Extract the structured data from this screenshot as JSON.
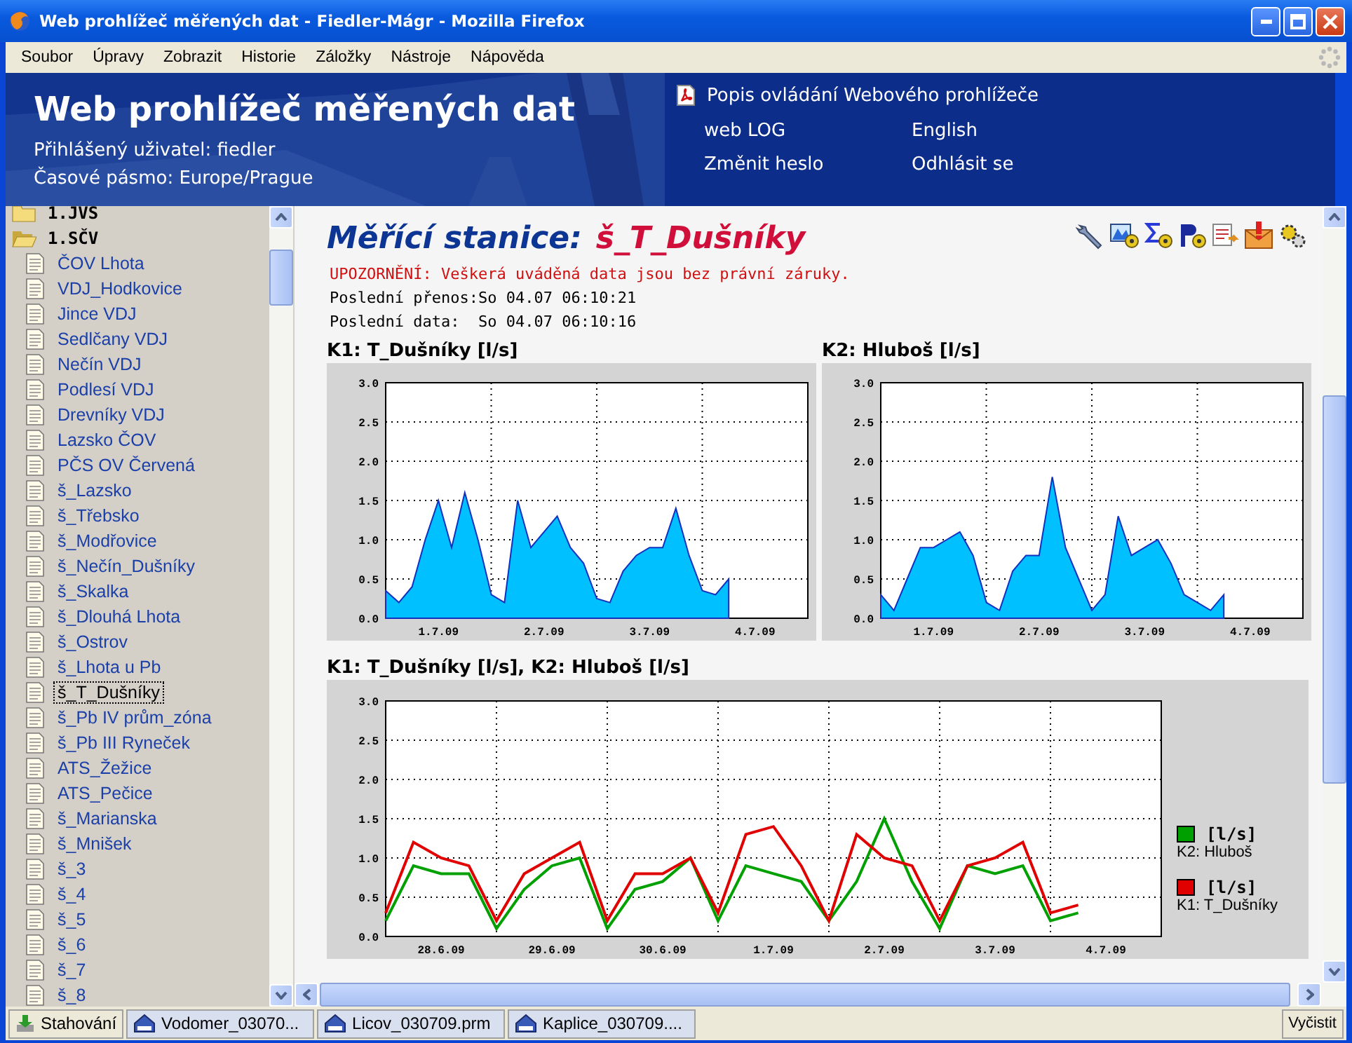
{
  "window": {
    "title": "Web prohlížeč měřených dat - Fiedler-Mágr - Mozilla Firefox"
  },
  "menu": [
    "Soubor",
    "Úpravy",
    "Zobrazit",
    "Historie",
    "Záložky",
    "Nástroje",
    "Nápověda"
  ],
  "header": {
    "title": "Web prohlížeč měřených dat",
    "user": "Přihlášený uživatel: fiedler",
    "timezone": "Časové pásmo: Europe/Prague",
    "manual_link": "Popis ovládání Webového prohlížeče",
    "links": [
      "web LOG",
      "English",
      "Změnit heslo",
      "Odhlásit se"
    ]
  },
  "sidebar": {
    "tree": [
      {
        "label": "1.JVS",
        "expanded": false,
        "selected": false
      },
      {
        "label": "1.SČV",
        "expanded": true,
        "selected": false,
        "children": [
          {
            "label": "ČOV Lhota",
            "selected": false
          },
          {
            "label": "VDJ_Hodkovice",
            "selected": false
          },
          {
            "label": "Jince VDJ",
            "selected": false
          },
          {
            "label": "Sedlčany VDJ",
            "selected": false
          },
          {
            "label": "Nečín VDJ",
            "selected": false
          },
          {
            "label": "Podlesí VDJ",
            "selected": false
          },
          {
            "label": "Drevníky VDJ",
            "selected": false
          },
          {
            "label": "Lazsko ČOV",
            "selected": false
          },
          {
            "label": "PČS OV Červená",
            "selected": false
          },
          {
            "label": "š_Lazsko",
            "selected": false
          },
          {
            "label": "š_Třebsko",
            "selected": false
          },
          {
            "label": "š_Modřovice",
            "selected": false
          },
          {
            "label": "š_Nečín_Dušníky",
            "selected": false
          },
          {
            "label": "š_Skalka",
            "selected": false
          },
          {
            "label": "š_Dlouhá Lhota",
            "selected": false
          },
          {
            "label": "š_Ostrov",
            "selected": false
          },
          {
            "label": "š_Lhota u Pb",
            "selected": false
          },
          {
            "label": "š_T_Dušníky",
            "selected": true
          },
          {
            "label": "š_Pb IV prům_zóna",
            "selected": false
          },
          {
            "label": "š_Pb III Ryneček",
            "selected": false
          },
          {
            "label": "ATS_Žežice",
            "selected": false
          },
          {
            "label": "ATS_Pečice",
            "selected": false
          },
          {
            "label": "š_Marianska",
            "selected": false
          },
          {
            "label": "š_Mnišek",
            "selected": false
          },
          {
            "label": "š_3",
            "selected": false
          },
          {
            "label": "š_4",
            "selected": false
          },
          {
            "label": "š_5",
            "selected": false
          },
          {
            "label": "š_6",
            "selected": false
          },
          {
            "label": "š_7",
            "selected": false
          },
          {
            "label": "š_8",
            "selected": false
          }
        ]
      }
    ]
  },
  "station": {
    "label": "Měřící stanice:",
    "name": "š_T_Dušníky",
    "warning": "UPOZORNĚNÍ: Veškerá uváděná data jsou bez právní záruky.",
    "info": [
      {
        "label": "Poslední přenos:",
        "value": "So 04.07 06:10:21"
      },
      {
        "label": "Poslední data:",
        "value": "So 04.07 06:10:16"
      }
    ]
  },
  "charts": [
    {
      "heading": "K1: T_Dušníky [l/s]",
      "chart_data": {
        "type": "area",
        "ylim": [
          0,
          3
        ],
        "grid": true,
        "categories": [
          null,
          null,
          null,
          null,
          "1.7.09",
          null,
          null,
          null,
          null,
          null,
          null,
          null,
          "2.7.09",
          null,
          null,
          null,
          null,
          null,
          null,
          null,
          "3.7.09",
          null,
          null,
          null,
          null,
          null,
          null,
          null,
          "4.7.09",
          null,
          null,
          null,
          null
        ],
        "yticks": [
          {
            "value": 0,
            "label": "0.0"
          },
          {
            "value": 0.5,
            "label": "0.5"
          },
          {
            "value": 1,
            "label": "1.0"
          },
          {
            "value": 1.5,
            "label": "1.5"
          },
          {
            "value": 2,
            "label": "2.0"
          },
          {
            "value": 2.5,
            "label": "2.5"
          },
          {
            "value": 3,
            "label": "3.0"
          }
        ],
        "series": [
          {
            "color": "#00c0ff",
            "values": [
              0.35,
              0.2,
              0.4,
              1.0,
              1.5,
              0.9,
              1.6,
              1.0,
              0.3,
              0.2,
              1.5,
              0.9,
              1.1,
              1.3,
              0.9,
              0.7,
              0.25,
              0.2,
              0.6,
              0.8,
              0.9,
              0.9,
              1.4,
              0.8,
              0.35,
              0.3,
              0.5,
              null,
              null,
              null,
              null,
              null,
              null
            ]
          }
        ]
      }
    },
    {
      "heading": "K2: Hluboš [l/s]",
      "chart_data": {
        "type": "area",
        "ylim": [
          0,
          3
        ],
        "grid": true,
        "categories": [
          null,
          null,
          null,
          null,
          "1.7.09",
          null,
          null,
          null,
          null,
          null,
          null,
          null,
          "2.7.09",
          null,
          null,
          null,
          null,
          null,
          null,
          null,
          "3.7.09",
          null,
          null,
          null,
          null,
          null,
          null,
          null,
          "4.7.09",
          null,
          null,
          null,
          null
        ],
        "yticks": [
          {
            "value": 0,
            "label": "0.0"
          },
          {
            "value": 0.5,
            "label": "0.5"
          },
          {
            "value": 1,
            "label": "1.0"
          },
          {
            "value": 1.5,
            "label": "1.5"
          },
          {
            "value": 2,
            "label": "2.0"
          },
          {
            "value": 2.5,
            "label": "2.5"
          },
          {
            "value": 3,
            "label": "3.0"
          }
        ],
        "series": [
          {
            "color": "#00c0ff",
            "values": [
              0.3,
              0.1,
              0.5,
              0.9,
              0.9,
              1.0,
              1.1,
              0.8,
              0.2,
              0.1,
              0.6,
              0.8,
              0.8,
              1.8,
              0.9,
              0.5,
              0.1,
              0.3,
              1.3,
              0.8,
              0.9,
              1.0,
              0.7,
              0.3,
              0.2,
              0.1,
              0.3,
              null,
              null,
              null,
              null,
              null,
              null
            ]
          }
        ]
      }
    },
    {
      "heading": "K1: T_Dušníky [l/s], K2: Hluboš [l/s]",
      "legend_units": [
        "[l/s]",
        "[l/s]"
      ],
      "chart_data": {
        "type": "line",
        "ylim": [
          0,
          3
        ],
        "grid": true,
        "categories": [
          null,
          null,
          "28.6.09",
          null,
          null,
          null,
          "29.6.09",
          null,
          null,
          null,
          "30.6.09",
          null,
          null,
          null,
          "1.7.09",
          null,
          null,
          null,
          "2.7.09",
          null,
          null,
          null,
          "3.7.09",
          null,
          null,
          null,
          "4.7.09",
          null,
          null
        ],
        "yticks": [
          {
            "value": 0,
            "label": "0.0"
          },
          {
            "value": 0.5,
            "label": "0.5"
          },
          {
            "value": 1,
            "label": "1.0"
          },
          {
            "value": 1.5,
            "label": "1.5"
          },
          {
            "value": 2,
            "label": "2.0"
          },
          {
            "value": 2.5,
            "label": "2.5"
          },
          {
            "value": 3,
            "label": "3.0"
          }
        ],
        "series": [
          {
            "name": "K2: Hluboš",
            "color": "#00a000",
            "values": [
              0.2,
              0.9,
              0.8,
              0.8,
              0.1,
              0.6,
              0.9,
              1.0,
              0.1,
              0.6,
              0.7,
              1.0,
              0.2,
              0.9,
              0.8,
              0.7,
              0.2,
              0.7,
              1.5,
              0.7,
              0.1,
              0.9,
              0.8,
              0.9,
              0.2,
              0.3,
              null,
              null,
              null
            ]
          },
          {
            "name": "K1: T_Dušníky",
            "color": "#e00000",
            "values": [
              0.3,
              1.2,
              1.0,
              0.9,
              0.2,
              0.8,
              1.0,
              1.2,
              0.2,
              0.8,
              0.8,
              1.0,
              0.3,
              1.3,
              1.4,
              0.9,
              0.2,
              1.3,
              1.0,
              0.9,
              0.2,
              0.9,
              1.0,
              1.2,
              0.3,
              0.4,
              null,
              null,
              null
            ]
          }
        ]
      }
    }
  ],
  "downloads": {
    "button": "Stahování",
    "files": [
      "Vodomer_03070...",
      "Licov_030709.prm",
      "Kaplice_030709...."
    ],
    "clear": "Vyčistit"
  }
}
